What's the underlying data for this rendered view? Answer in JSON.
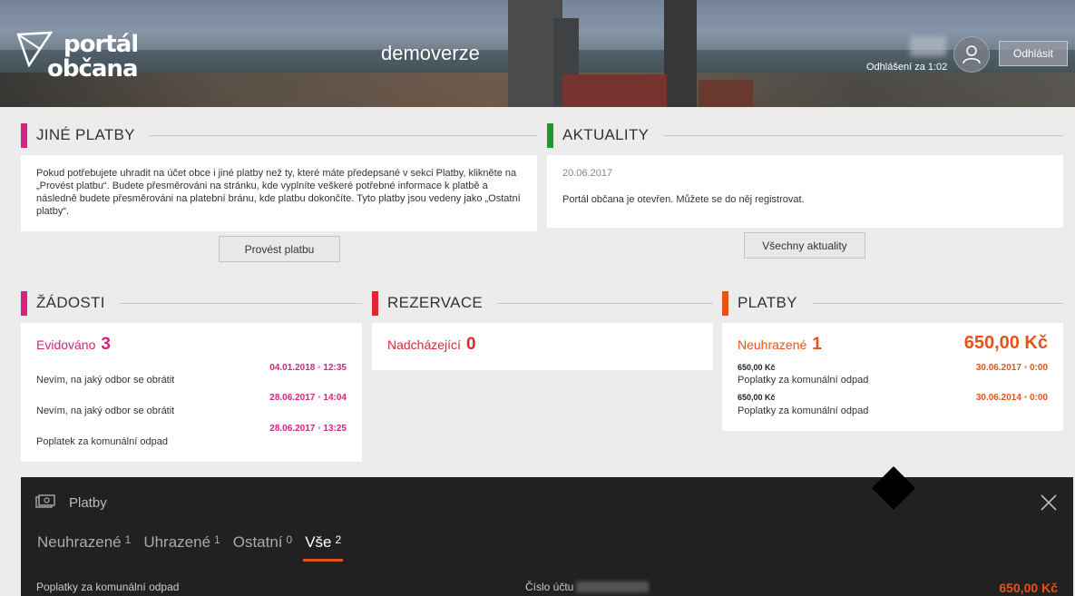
{
  "header": {
    "logo_line1": "portál",
    "logo_line2": "občana",
    "demo_label": "demoverze",
    "logout_label": "Odhlásit",
    "session_text": "Odhlášení za 1:02"
  },
  "jine_platby": {
    "title": "JINÉ PLATBY",
    "text": "Pokud potřebujete uhradit na účet obce i jiné platby než ty, které máte předepsané v sekci Platby, klikněte na „Provést platbu“. Budete přesměrováni na stránku, kde vyplníte veškeré potřebné informace k platbě a následně budete přesměrováni na platební bránu, kde platbu dokončíte. Tyto platby jsou vedeny jako „Ostatní platby“.",
    "button": "Provést platbu",
    "color": "#d6237f"
  },
  "aktuality": {
    "title": "AKTUALITY",
    "date": "20.06.2017",
    "text": "Portál občana je otevřen. Můžete se do něj registrovat.",
    "button": "Všechny aktuality",
    "color": "#1a9a2e"
  },
  "zadosti": {
    "title": "ŽÁDOSTI",
    "status_label": "Evidováno",
    "count": "3",
    "color": "#d6237f",
    "items": [
      {
        "date": "04.01.2018",
        "time": "12:35",
        "text": "Nevím, na jaký odbor se obrátit"
      },
      {
        "date": "28.06.2017",
        "time": "14:04",
        "text": "Nevím, na jaký odbor se obrátit"
      },
      {
        "date": "28.06.2017",
        "time": "13:25",
        "text": "Poplatek za komunální odpad"
      }
    ]
  },
  "rezervace": {
    "title": "REZERVACE",
    "status_label": "Nadcházející",
    "count": "0",
    "color": "#e0262f"
  },
  "platby": {
    "title": "PLATBY",
    "status_label": "Neuhrazené",
    "count": "1",
    "total": "650,00 Kč",
    "color": "#e8521a",
    "items": [
      {
        "amount": "650,00 Kč",
        "date": "30.06.2017",
        "time": "0:00",
        "text": "Poplatky za komunální odpad"
      },
      {
        "amount": "650,00 Kč",
        "date": "30.06.2014",
        "time": "0:00",
        "text": "Poplatky za komunální odpad"
      }
    ]
  },
  "panel": {
    "title": "Platby",
    "tabs": [
      {
        "label": "Neuhrazené",
        "count": "1"
      },
      {
        "label": "Uhrazené",
        "count": "1"
      },
      {
        "label": "Ostatní",
        "count": "0"
      },
      {
        "label": "Vše",
        "count": "2"
      }
    ],
    "row_name": "Poplatky za komunální odpad",
    "account_label": "Číslo účtu",
    "row_amount": "650,00 Kč"
  }
}
